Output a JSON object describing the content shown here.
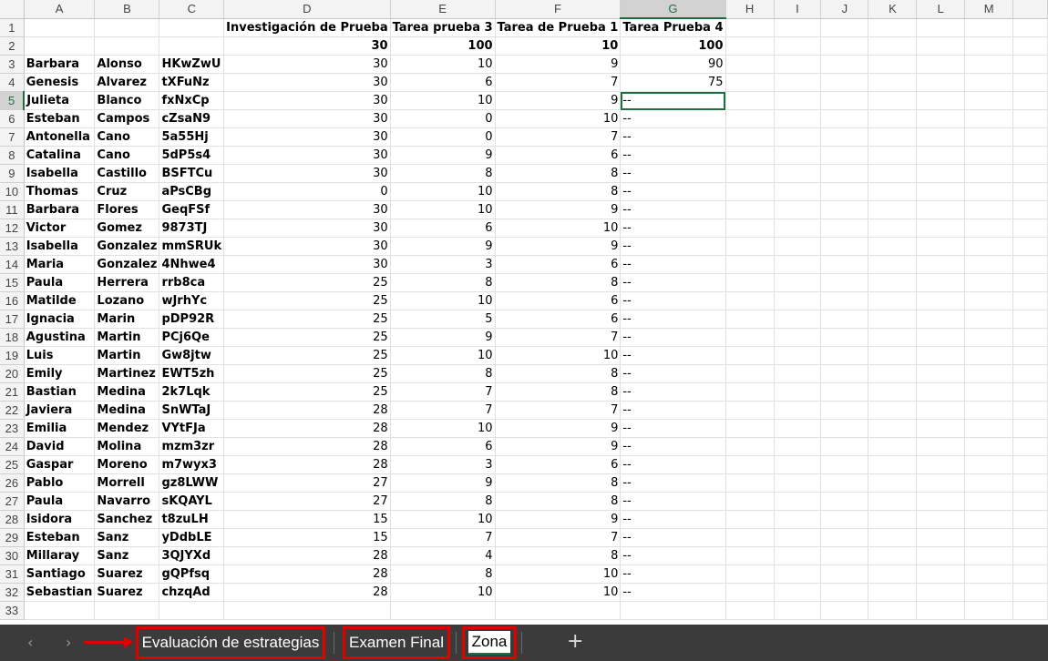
{
  "columns": [
    "A",
    "B",
    "C",
    "D",
    "E",
    "F",
    "G",
    "H",
    "I",
    "J",
    "K",
    "L",
    "M"
  ],
  "header_row1": {
    "D": "Investigación de Prueba",
    "E": "Tarea prueba 3",
    "F": "Tarea de Prueba 1",
    "G": "Tarea Prueba 4"
  },
  "header_row2": {
    "D": "30",
    "E": "100",
    "F": "10",
    "G": "100"
  },
  "students": [
    {
      "first": "Barbara",
      "last": "Alonso",
      "code": "HKwZwU",
      "d": "30",
      "e": "10",
      "f": "9",
      "g": "90"
    },
    {
      "first": "Genesis",
      "last": "Alvarez",
      "code": "tXFuNz",
      "d": "30",
      "e": "6",
      "f": "7",
      "g": "75"
    },
    {
      "first": "Julieta",
      "last": "Blanco",
      "code": "fxNxCp",
      "d": "30",
      "e": "10",
      "f": "9",
      "g": "--"
    },
    {
      "first": "Esteban",
      "last": "Campos",
      "code": "cZsaN9",
      "d": "30",
      "e": "0",
      "f": "10",
      "g": "--"
    },
    {
      "first": "Antonella",
      "last": "Cano",
      "code": "5a55Hj",
      "d": "30",
      "e": "0",
      "f": "7",
      "g": "--"
    },
    {
      "first": "Catalina",
      "last": "Cano",
      "code": "5dP5s4",
      "d": "30",
      "e": "9",
      "f": "6",
      "g": "--"
    },
    {
      "first": "Isabella",
      "last": "Castillo",
      "code": "BSFTCu",
      "d": "30",
      "e": "8",
      "f": "8",
      "g": "--"
    },
    {
      "first": "Thomas",
      "last": "Cruz",
      "code": "aPsCBg",
      "d": "0",
      "e": "10",
      "f": "8",
      "g": "--"
    },
    {
      "first": "Barbara",
      "last": "Flores",
      "code": "GeqFSf",
      "d": "30",
      "e": "10",
      "f": "9",
      "g": "--"
    },
    {
      "first": "Victor",
      "last": "Gomez",
      "code": "9873TJ",
      "d": "30",
      "e": "6",
      "f": "10",
      "g": "--"
    },
    {
      "first": "Isabella",
      "last": "Gonzalez",
      "code": "mmSRUk",
      "d": "30",
      "e": "9",
      "f": "9",
      "g": "--"
    },
    {
      "first": "Maria",
      "last": "Gonzalez",
      "code": "4Nhwe4",
      "d": "30",
      "e": "3",
      "f": "6",
      "g": "--"
    },
    {
      "first": "Paula",
      "last": "Herrera",
      "code": "rrb8ca",
      "d": "25",
      "e": "8",
      "f": "8",
      "g": "--"
    },
    {
      "first": "Matilde",
      "last": "Lozano",
      "code": "wJrhYc",
      "d": "25",
      "e": "10",
      "f": "6",
      "g": "--"
    },
    {
      "first": "Ignacia",
      "last": "Marin",
      "code": "pDP92R",
      "d": "25",
      "e": "5",
      "f": "6",
      "g": "--"
    },
    {
      "first": "Agustina",
      "last": "Martin",
      "code": "PCj6Qe",
      "d": "25",
      "e": "9",
      "f": "7",
      "g": "--"
    },
    {
      "first": "Luis",
      "last": "Martin",
      "code": "Gw8jtw",
      "d": "25",
      "e": "10",
      "f": "10",
      "g": "--"
    },
    {
      "first": "Emily",
      "last": "Martinez",
      "code": "EWT5zh",
      "d": "25",
      "e": "8",
      "f": "8",
      "g": "--"
    },
    {
      "first": "Bastian",
      "last": "Medina",
      "code": "2k7Lqk",
      "d": "25",
      "e": "7",
      "f": "8",
      "g": "--"
    },
    {
      "first": "Javiera",
      "last": "Medina",
      "code": "SnWTaJ",
      "d": "28",
      "e": "7",
      "f": "7",
      "g": "--"
    },
    {
      "first": "Emilia",
      "last": "Mendez",
      "code": "VYtFJa",
      "d": "28",
      "e": "10",
      "f": "9",
      "g": "--"
    },
    {
      "first": "David",
      "last": "Molina",
      "code": "mzm3zr",
      "d": "28",
      "e": "6",
      "f": "9",
      "g": "--"
    },
    {
      "first": "Gaspar",
      "last": "Moreno",
      "code": "m7wyx3",
      "d": "28",
      "e": "3",
      "f": "6",
      "g": "--"
    },
    {
      "first": "Pablo",
      "last": "Morrell",
      "code": "gz8LWW",
      "d": "27",
      "e": "9",
      "f": "8",
      "g": "--"
    },
    {
      "first": "Paula",
      "last": "Navarro",
      "code": "sKQAYL",
      "d": "27",
      "e": "8",
      "f": "8",
      "g": "--"
    },
    {
      "first": "Isidora",
      "last": "Sanchez",
      "code": "t8zuLH",
      "d": "15",
      "e": "10",
      "f": "9",
      "g": "--"
    },
    {
      "first": "Esteban",
      "last": "Sanz",
      "code": "yDdbLE",
      "d": "15",
      "e": "7",
      "f": "7",
      "g": "--"
    },
    {
      "first": "Millaray",
      "last": "Sanz",
      "code": "3QJYXd",
      "d": "28",
      "e": "4",
      "f": "8",
      "g": "--"
    },
    {
      "first": "Santiago",
      "last": "Suarez",
      "code": "gQPfsq",
      "d": "28",
      "e": "8",
      "f": "10",
      "g": "--"
    },
    {
      "first": "Sebastian",
      "last": "Suarez",
      "code": "chzqAd",
      "d": "28",
      "e": "10",
      "f": "10",
      "g": "--"
    }
  ],
  "selected_cell": "G5",
  "tabs": [
    {
      "label": "Evaluación de estrategias",
      "highlighted": true,
      "active": false
    },
    {
      "label": "Examen Final",
      "highlighted": true,
      "active": false
    },
    {
      "label": "Zona",
      "highlighted": true,
      "active": true
    }
  ],
  "add_sheet_symbol": "+",
  "nav_prev_symbol": "‹",
  "nav_next_symbol": "›",
  "colors": {
    "accent": "#1e6e42",
    "highlight": "#e00000",
    "tabbar": "#3b3b3b"
  }
}
